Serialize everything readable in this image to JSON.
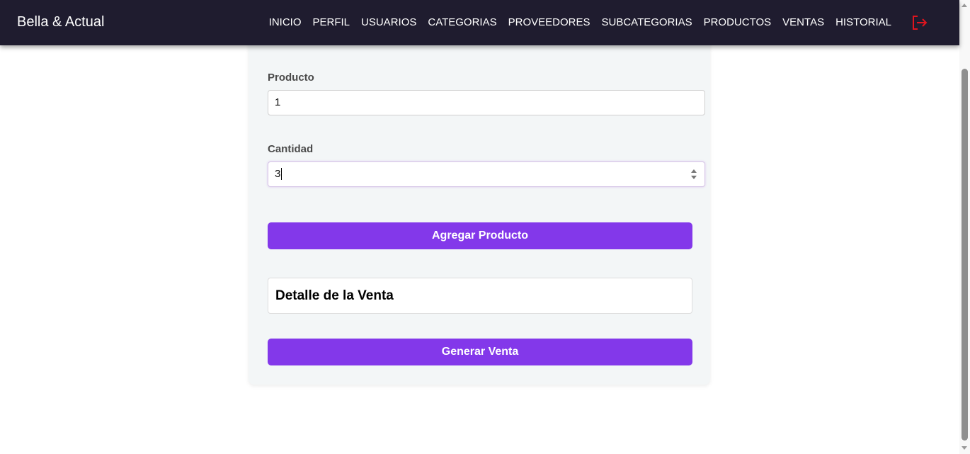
{
  "nav": {
    "brand": "Bella & Actual",
    "items": [
      "INICIO",
      "PERFIL",
      "USUARIOS",
      "CATEGORIAS",
      "PROVEEDORES",
      "SUBCATEGORIAS",
      "PRODUCTOS",
      "VENTAS",
      "HISTORIAL"
    ],
    "logout_icon": "logout-icon",
    "logout_color": "#e0141e"
  },
  "form": {
    "producto_label": "Producto",
    "producto_value": "1",
    "cantidad_label": "Cantidad",
    "cantidad_value": "3",
    "add_button": "Agregar Producto",
    "detail_title": "Detalle de la Venta",
    "generate_button": "Generar Venta"
  },
  "colors": {
    "navbar": "#1f1c2f",
    "accent": "#8338ea",
    "card": "#f3f6f7"
  }
}
